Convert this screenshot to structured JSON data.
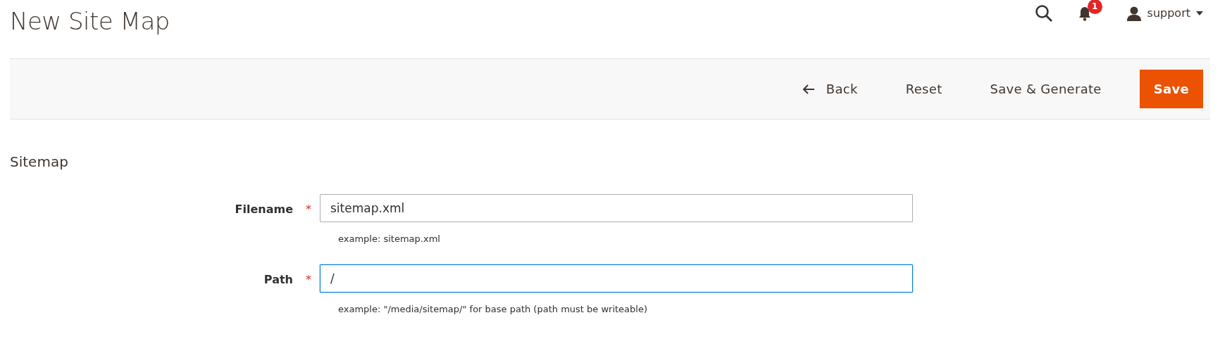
{
  "page": {
    "title": "New Site Map"
  },
  "header": {
    "notifications": {
      "count": "1"
    },
    "user": {
      "name": "support"
    }
  },
  "toolbar": {
    "buttons": [
      {
        "label": "Back",
        "kind": "back"
      },
      {
        "label": "Reset",
        "kind": "plain"
      },
      {
        "label": "Save & Generate",
        "kind": "plain"
      },
      {
        "label": "Save",
        "kind": "primary"
      }
    ]
  },
  "section": {
    "title": "Sitemap",
    "fields": [
      {
        "label": "Filename",
        "required": true,
        "required_mark": "*",
        "value": "sitemap.xml",
        "focused": false,
        "note": "example: sitemap.xml"
      },
      {
        "label": "Path",
        "required": true,
        "required_mark": "*",
        "value": "/",
        "focused": true,
        "note": "example: \"/media/sitemap/\" for base path (path must be writeable)"
      }
    ]
  }
}
